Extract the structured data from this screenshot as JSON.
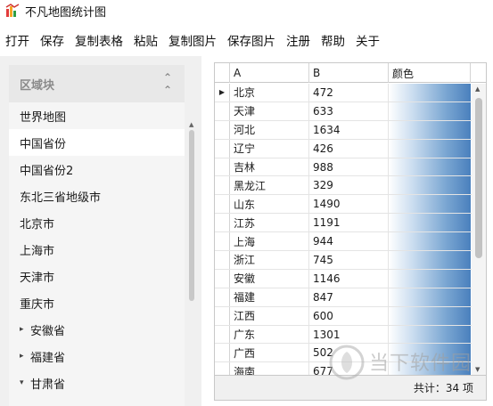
{
  "window": {
    "title": "不凡地图统计图"
  },
  "menu": {
    "items": [
      "打开",
      "保存",
      "复制表格",
      "粘贴",
      "复制图片",
      "保存图片",
      "注册",
      "帮助",
      "关于"
    ]
  },
  "region_panel": {
    "header": "区域块",
    "items": [
      {
        "label": "世界地图",
        "has_arrow": false,
        "arrow": ""
      },
      {
        "label": "中国省份",
        "has_arrow": false,
        "arrow": "",
        "selected": true
      },
      {
        "label": "中国省份2",
        "has_arrow": false,
        "arrow": ""
      },
      {
        "label": "东北三省地级市",
        "has_arrow": false,
        "arrow": ""
      },
      {
        "label": "北京市",
        "has_arrow": false,
        "arrow": ""
      },
      {
        "label": "上海市",
        "has_arrow": false,
        "arrow": ""
      },
      {
        "label": "天津市",
        "has_arrow": false,
        "arrow": ""
      },
      {
        "label": "重庆市",
        "has_arrow": false,
        "arrow": ""
      },
      {
        "label": "安徽省",
        "has_arrow": true,
        "arrow": "▸"
      },
      {
        "label": "福建省",
        "has_arrow": true,
        "arrow": "▸"
      },
      {
        "label": "甘肃省",
        "has_arrow": true,
        "arrow": "▾"
      }
    ]
  },
  "grid": {
    "columns": [
      "A",
      "B",
      "颜色"
    ],
    "rows": [
      {
        "a": "北京",
        "b": "472",
        "current": true
      },
      {
        "a": "天津",
        "b": "633"
      },
      {
        "a": "河北",
        "b": "1634"
      },
      {
        "a": "辽宁",
        "b": "426"
      },
      {
        "a": "吉林",
        "b": "988"
      },
      {
        "a": "黑龙江",
        "b": "329"
      },
      {
        "a": "山东",
        "b": "1490"
      },
      {
        "a": "江苏",
        "b": "1191"
      },
      {
        "a": "上海",
        "b": "944"
      },
      {
        "a": "浙江",
        "b": "745"
      },
      {
        "a": "安徽",
        "b": "1146"
      },
      {
        "a": "福建",
        "b": "847"
      },
      {
        "a": "江西",
        "b": "600"
      },
      {
        "a": "广东",
        "b": "1301"
      },
      {
        "a": "广西",
        "b": "502"
      },
      {
        "a": "海南",
        "b": "677"
      }
    ],
    "row_indicator": "▶",
    "footer": "共计：34 项"
  },
  "watermark": {
    "text": "当下软件园"
  },
  "colors": {
    "gradient_start": "#ffffff",
    "gradient_end": "#4a80bd",
    "panel_bg": "#f0f0f0"
  }
}
